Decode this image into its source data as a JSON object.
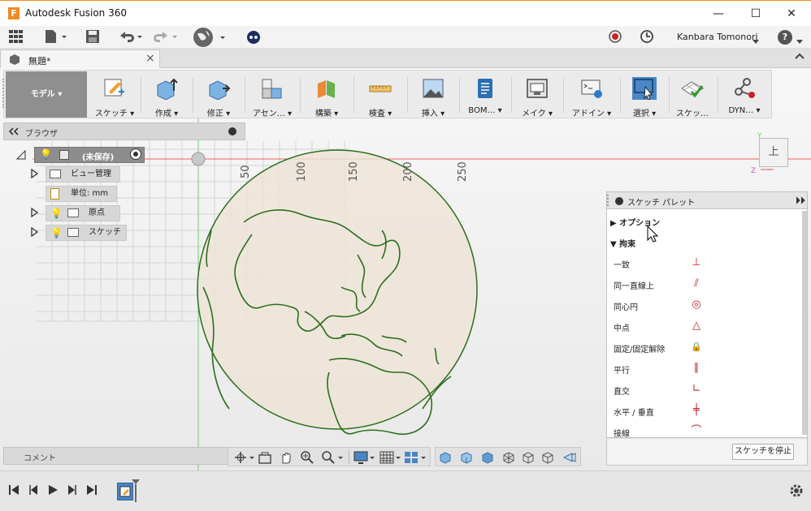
{
  "app": {
    "title": "Autodesk Fusion 360",
    "logo_letter": "F"
  },
  "window": {
    "minimize": "—",
    "maximize": "☐",
    "close": "✕"
  },
  "qat": {
    "user": "Kanbara Tomonori",
    "help": "?"
  },
  "document": {
    "tab_label": "無題*",
    "close": "×"
  },
  "toolbar": {
    "workspace": "モデル",
    "groups": [
      {
        "label": "スケッチ",
        "icon": "sketch-icon"
      },
      {
        "label": "作成",
        "icon": "create-icon"
      },
      {
        "label": "修正",
        "icon": "modify-icon"
      },
      {
        "label": "アセン…",
        "icon": "assemble-icon"
      },
      {
        "label": "構築",
        "icon": "construct-icon"
      },
      {
        "label": "検査",
        "icon": "inspect-icon"
      },
      {
        "label": "挿入",
        "icon": "insert-icon"
      },
      {
        "label": "BOM…",
        "icon": "bom-icon"
      },
      {
        "label": "メイク",
        "icon": "make-icon"
      },
      {
        "label": "アドイン",
        "icon": "addin-icon"
      },
      {
        "label": "選択",
        "icon": "select-icon"
      },
      {
        "label": "スケッ…",
        "icon": "sketch-finish-icon"
      },
      {
        "label": "DYN…",
        "icon": "dynamo-icon"
      }
    ]
  },
  "browser": {
    "title": "ブラウザ",
    "root": "(未保存)",
    "items": [
      {
        "label": "ビュー管理"
      },
      {
        "label": "単位: mm"
      },
      {
        "label": "原点"
      },
      {
        "label": "スケッチ"
      }
    ]
  },
  "ruler": {
    "ticks": [
      "50",
      "100",
      "150",
      "200",
      "250"
    ]
  },
  "viewcube": {
    "face": "上"
  },
  "palette": {
    "title": "スケッチ パレット",
    "options": "オプション",
    "constraints": "拘束",
    "items": [
      {
        "label": "一致",
        "icon": "coincident-icon",
        "glyph": "⊥"
      },
      {
        "label": "同一直線上",
        "icon": "collinear-icon",
        "glyph": "⫽"
      },
      {
        "label": "同心円",
        "icon": "concentric-icon",
        "glyph": "◎"
      },
      {
        "label": "中点",
        "icon": "midpoint-icon",
        "glyph": "△"
      },
      {
        "label": "固定/固定解除",
        "icon": "lock-icon",
        "glyph": "🔒"
      },
      {
        "label": "平行",
        "icon": "parallel-icon",
        "glyph": "∥"
      },
      {
        "label": "直交",
        "icon": "perpendicular-icon",
        "glyph": "∟"
      },
      {
        "label": "水平 / 垂直",
        "icon": "horizontal-vertical-icon",
        "glyph": "╪"
      },
      {
        "label": "接線",
        "icon": "tangent-icon",
        "glyph": "⌒"
      }
    ],
    "stop_button": "スケッチを停止"
  },
  "comment": {
    "label": "コメント"
  },
  "colors": {
    "accent": "#f08a24",
    "globe_stroke": "#2d6e1e",
    "globe_fill": "#eee3d6",
    "constraint": "#c8202a"
  }
}
